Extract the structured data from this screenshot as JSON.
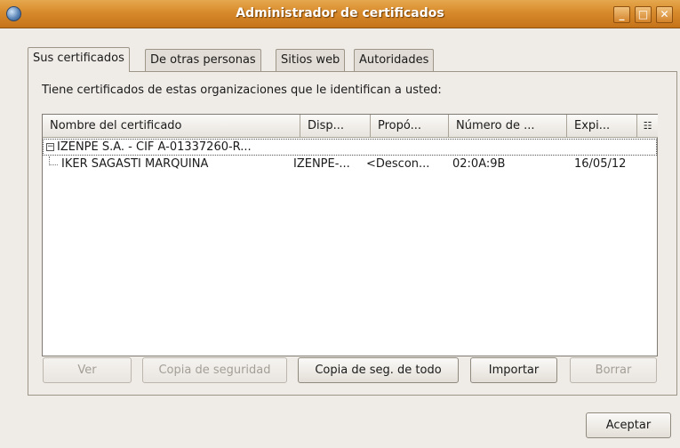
{
  "window": {
    "title": "Administrador de certificados"
  },
  "tabs": [
    {
      "label": "Sus certificados",
      "active": true
    },
    {
      "label": "De otras personas",
      "active": false
    },
    {
      "label": "Sitios web",
      "active": false
    },
    {
      "label": "Autoridades",
      "active": false
    }
  ],
  "description": "Tiene certificados de estas organizaciones que le identifican a usted:",
  "table": {
    "columns": [
      "Nombre del certificado",
      "Disp...",
      "Propó...",
      "Número de ...",
      "Expi..."
    ],
    "group": {
      "name": "IZENPE S.A. - CIF A-01337260-R...",
      "expanded": true
    },
    "rows": [
      {
        "name": "IKER SAGASTI MARQUINA",
        "device": "IZENPE-...",
        "purpose": "<Descon...",
        "serial": "02:0A:9B",
        "expires": "16/05/12"
      }
    ]
  },
  "buttons": {
    "view": "Ver",
    "backup": "Copia de seguridad",
    "backup_all": "Copia de seg. de todo",
    "import": "Importar",
    "delete": "Borrar",
    "ok": "Aceptar"
  },
  "colors": {
    "titlebar": "#d78a2b",
    "window_bg": "#efebe7"
  }
}
